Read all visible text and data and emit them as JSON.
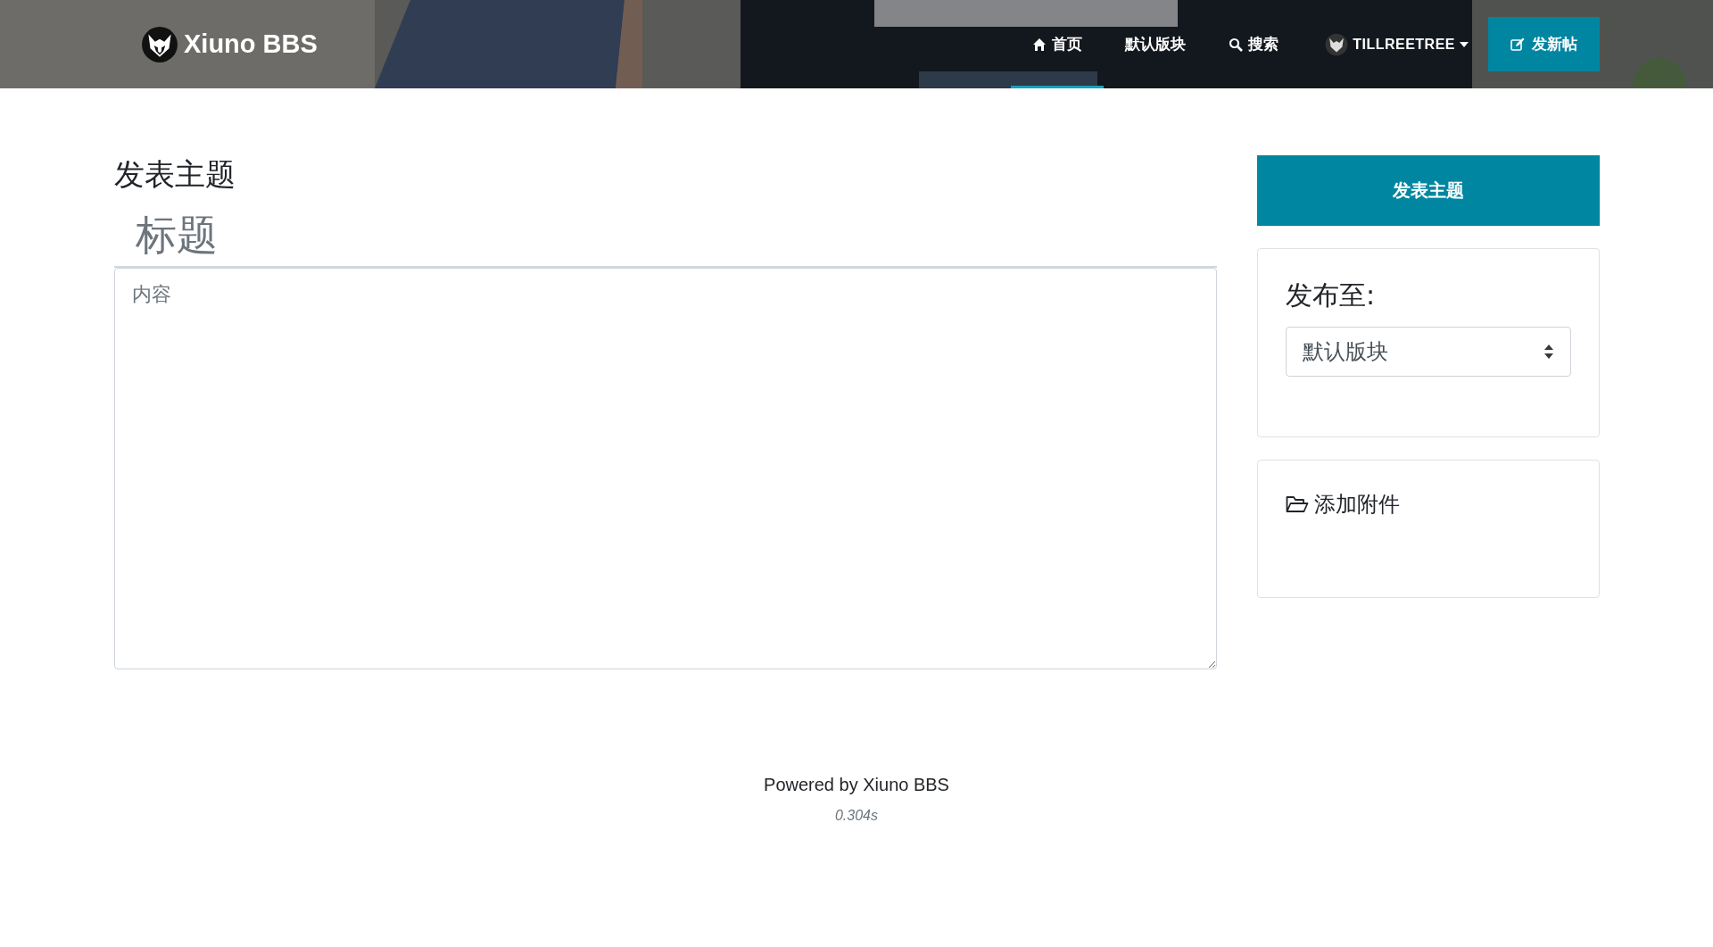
{
  "header": {
    "logo_text": "Xiuno BBS",
    "nav": [
      {
        "label": "首页",
        "kind": "home",
        "selected": true
      },
      {
        "label": "默认版块",
        "kind": "plain",
        "selected": false
      },
      {
        "label": "搜索",
        "kind": "search",
        "selected": false
      }
    ],
    "user": {
      "name": "TILLREETREE"
    },
    "new_post_button": "发新帖"
  },
  "main": {
    "heading": "发表主题",
    "title_placeholder": "标题",
    "content_placeholder": "内容"
  },
  "sidebar": {
    "submit_button": "发表主题",
    "publish_label": "发布至:",
    "forum_select": "默认版块",
    "attach_label": "添加附件"
  },
  "footer": {
    "powered": "Powered by Xiuno BBS",
    "time": "0.304s"
  }
}
